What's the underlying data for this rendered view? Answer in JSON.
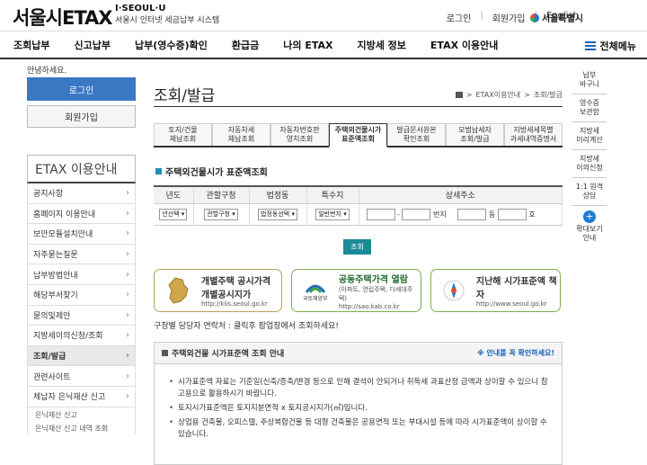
{
  "header": {
    "logo_text_1": "서울시",
    "logo_text_2": "ETAX",
    "brand_line": "I·SEOUL·U",
    "brand_sub": "서울시 인터넷 세금납부 시스템",
    "util_links": [
      "로그인",
      "회원가입",
      "English"
    ],
    "seoul_logo": "서울특별시"
  },
  "gnb": {
    "items": [
      "조회납부",
      "신고납부",
      "납부(영수증)확인",
      "환급금",
      "나의 ETAX",
      "지방세 정보",
      "ETAX 이용안내"
    ],
    "all_menu": "전체메뉴"
  },
  "sidebar": {
    "greeting": "안녕하세요.",
    "login": "로그인",
    "join": "회원가입",
    "title": "ETAX 이용안내",
    "items": [
      {
        "label": "공지사항",
        "arrow": "›"
      },
      {
        "label": "홈페이지 이용안내",
        "arrow": "›"
      },
      {
        "label": "보안모듈설치안내",
        "arrow": "›"
      },
      {
        "label": "자주묻는질문",
        "arrow": "›"
      },
      {
        "label": "납부방법안내",
        "arrow": "›"
      },
      {
        "label": "해당부서찾기",
        "arrow": "›"
      },
      {
        "label": "묻의및제안",
        "arrow": "›"
      },
      {
        "label": "지방세이의신청/조회",
        "arrow": "›"
      },
      {
        "label": "조회/발급",
        "arrow": "›"
      },
      {
        "label": "관련사이트",
        "arrow": "›"
      },
      {
        "label": "체납자 은닉재산 신고",
        "arrow": "›"
      }
    ],
    "sub_items": [
      "은닉재산 신고",
      "은닉재산 신고 내역 조회"
    ]
  },
  "content": {
    "title": "조회/발급",
    "breadcrumb": [
      "ETAX이용안내",
      "조회/발급"
    ],
    "breadcrumb_sep": ">",
    "tabs": [
      {
        "l1": "토지/건물",
        "l2": "체납조회"
      },
      {
        "l1": "자동차세",
        "l2": "체납조회"
      },
      {
        "l1": "자동차번호판",
        "l2": "영치조회"
      },
      {
        "l1": "주택외건물시가",
        "l2": "표준액조회"
      },
      {
        "l1": "발급문서원본",
        "l2": "확인조회"
      },
      {
        "l1": "모범납세자",
        "l2": "조회/발급"
      },
      {
        "l1": "지방세세목별",
        "l2": "과세내역증명서"
      }
    ],
    "section_title": "주택외건물시가 표준액조회",
    "table_headers": [
      "년도",
      "관할구청",
      "법정동",
      "특수지",
      "상세주소"
    ],
    "selects": [
      "년선택",
      "관할구청",
      "법정동선택",
      "일반번지"
    ],
    "addr_labels": {
      "dash": "-",
      "bunji": "번지",
      "dong": "동",
      "ho": "호"
    },
    "query_button": "조회",
    "banners": [
      {
        "t1": "개별주택 공시가격",
        "t2a": "개별공시지가",
        "t2": "http://klis.seoul.go.kr"
      },
      {
        "logo": "국토해양부",
        "t1": "공동주택가격 열람",
        "t2a": "(아파트, 연립주택, 다세대주택)",
        "t2": "http://sao.kab.co.kr"
      },
      {
        "t1": "지난해 시가표준액 책자",
        "t2": "http://www.seoul.go.kr"
      }
    ],
    "contact_text": "구청별 담당자 연락처 : 클릭후 팝업창에서 조회하세요!",
    "info_title": "주택외건물 시가표준액 조회 안내",
    "info_note": "※ 안내를 꼭 확인하세요!",
    "info_lines": [
      "시가표준액 자료는 기준일(신축/증축/변경 등으로 인해 결석이 안되거나 취득세 과표산정 금액과 상이할 수 있으니 참고용으로 활용하시기 바랍니다.",
      "토지시가표준액은 토지지분면적 x 토지공시지가(㎡)입니다.",
      "상업용 건축물, 오피스텔, 주상복합건물 등 대형 건축물은 공용면적 또는 부대시설 등에 따라 시가표준액이 상이할 수 있습니다."
    ]
  },
  "quick": {
    "items": [
      "납부\n바구니",
      "영수증\n보관함",
      "지방세\n미리계산",
      "지방세\n이의신청",
      "1:1 원격\n상담"
    ],
    "plus": "+",
    "more": "확대보기\n안내"
  },
  "colors": {
    "primary": "#3a78c3",
    "teal": "#1c8a97",
    "link": "#1a63b8"
  }
}
